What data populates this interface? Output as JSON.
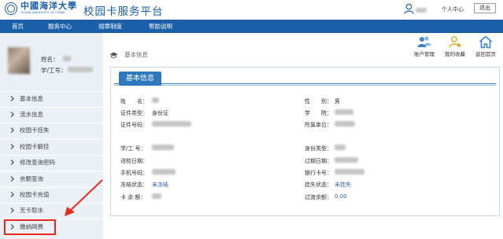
{
  "header": {
    "logo_cn": "中國海洋大學",
    "logo_en": "OCEAN UNIVERSITY OF CHINA",
    "app_title": "校园卡服务平台",
    "personal_center": "个人中心",
    "logout": "退出"
  },
  "nav": {
    "items": [
      "首页",
      "服务中心",
      "规章制度",
      "帮助说明"
    ]
  },
  "profile": {
    "name_label": "姓名：",
    "id_label": "学/工号："
  },
  "sidebar": {
    "items": [
      "基本信息",
      "流水信息",
      "校园卡挂失",
      "校园卡解挂",
      "修改查询密码",
      "余额查询",
      "校园卡充值",
      "无卡取水",
      "缴纳网费"
    ]
  },
  "breadcrumb": "基本信息",
  "toolbar": {
    "account": "账户管理",
    "favorites": "我的收藏",
    "home": "返回首页"
  },
  "panel": {
    "title": "基本信息",
    "fields": {
      "name_label": "姓　　名：",
      "id_type_label": "证件类型：",
      "id_type_value": "身份证",
      "id_number_label": "证件号码：",
      "gender_label": "性　　别：",
      "gender_value": "男",
      "college_label": "学　　院：",
      "unit_label": "所属单位：",
      "student_id_label": "学/工 号：",
      "enroll_label": "进校日期：",
      "phone_label": "手机号码：",
      "freeze_label": "冻结状态：",
      "freeze_value": "未冻结",
      "balance_label": "卡 余 额：",
      "identity_label": "身份类型：",
      "expiry_label": "过期日期：",
      "bank_label": "银行卡号：",
      "loss_label": "挂失状态：",
      "loss_value": "未挂失",
      "transition_label": "过渡余额：",
      "transition_value": "0.00"
    }
  },
  "colors": {
    "brand": "#1a5fa8",
    "tab": "#2f78be",
    "highlight": "#e8281e",
    "sidebar_bg": "#eaf0f6"
  }
}
